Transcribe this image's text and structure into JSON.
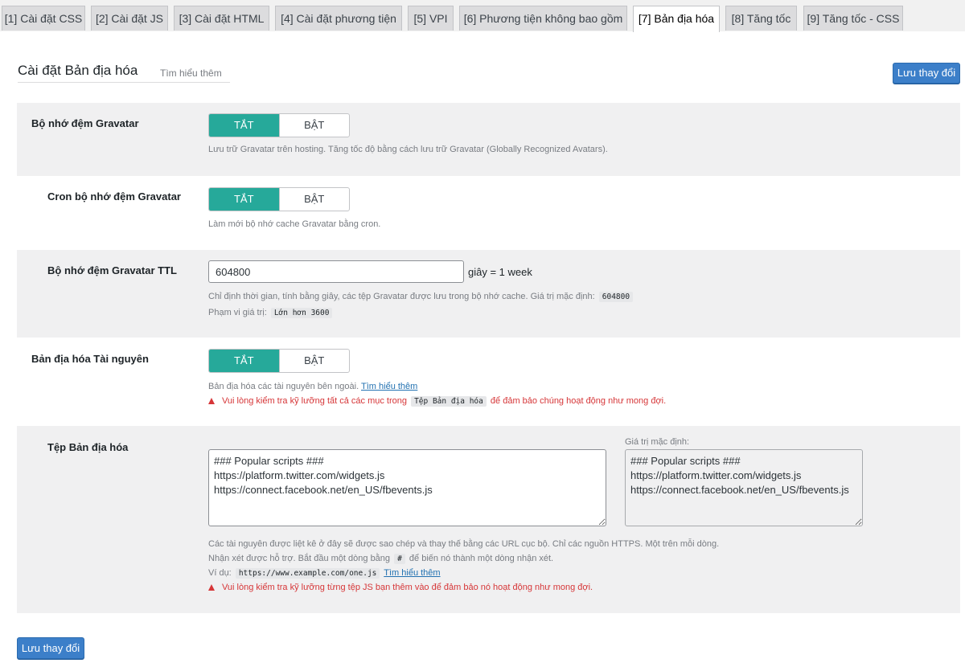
{
  "tabs": [
    {
      "label": "[1] Cài đặt CSS"
    },
    {
      "label": "[2] Cài đặt JS"
    },
    {
      "label": "[3] Cài đặt HTML"
    },
    {
      "label": "[4] Cài đặt phương tiện"
    },
    {
      "label": "[5] VPI"
    },
    {
      "label": "[6] Phương tiện không bao gồm"
    },
    {
      "label": "[7] Bản địa hóa"
    },
    {
      "label": "[8] Tăng tốc"
    },
    {
      "label": "[9] Tăng tốc - CSS"
    }
  ],
  "header": {
    "title": "Cài đặt Bản địa hóa",
    "learn_more": "Tìm hiểu thêm",
    "save_label": "Lưu thay đổi"
  },
  "gravatar_cache": {
    "label": "Bộ nhớ đệm Gravatar",
    "off": "TẮT",
    "on": "BẬT",
    "selected": "off",
    "desc": "Lưu trữ Gravatar trên hosting. Tăng tốc độ bằng cách lưu trữ Gravatar (Globally Recognized Avatars)."
  },
  "gravatar_cron": {
    "label": "Cron bộ nhớ đệm Gravatar",
    "off": "TẮT",
    "on": "BẬT",
    "selected": "off",
    "desc": "Làm mới bộ nhớ cache Gravatar bằng cron."
  },
  "gravatar_ttl": {
    "label": "Bộ nhớ đệm Gravatar TTL",
    "value": "604800",
    "suffix": "giây = 1 week",
    "desc": "Chỉ định thời gian, tính bằng giây, các tệp Gravatar được lưu trong bộ nhớ cache. Giá trị mặc định:",
    "default_value": "604800",
    "range_label": "Phạm vi giá trị:",
    "range_value": "Lớn hơn 3600"
  },
  "localize_resources": {
    "label": "Bản địa hóa Tài nguyên",
    "off": "TẮT",
    "on": "BẬT",
    "selected": "off",
    "desc": "Bản địa hóa các tài nguyên bên ngoài.",
    "learn_more": "Tìm hiểu thêm",
    "warn_before": "Vui lòng kiểm tra kỹ lưỡng tất cả các mục trong",
    "warn_code": "Tệp Bản địa hóa",
    "warn_after": "để đảm bảo chúng hoạt động như mong đợi."
  },
  "localize_files": {
    "label": "Tệp Bản địa hóa",
    "value": "### Popular scripts ###\nhttps://platform.twitter.com/widgets.js\nhttps://connect.facebook.net/en_US/fbevents.js",
    "default_label": "Giá trị mặc định:",
    "default_value": "### Popular scripts ###\nhttps://platform.twitter.com/widgets.js\nhttps://connect.facebook.net/en_US/fbevents.js",
    "desc1": "Các tài nguyên được liệt kê ở đây sẽ được sao chép và thay thế bằng các URL cục bộ. Chỉ các nguồn HTTPS. Một trên mỗi dòng.",
    "desc2_before": "Nhận xét được hỗ trợ. Bắt đầu một dòng bằng",
    "desc2_code": "#",
    "desc2_after": "để biến nó thành một dòng nhận xét.",
    "example_label": "Ví dụ:",
    "example_code": "https://www.example.com/one.js",
    "learn_more": "Tìm hiểu thêm",
    "warn": "Vui lòng kiểm tra kỹ lưỡng từng tệp JS bạn thêm vào để đảm bảo nó hoạt động như mong đợi."
  },
  "footer": {
    "save_label": "Lưu thay đổi"
  },
  "colors": {
    "toggle_active": "#26a99a",
    "primary_button": "#3c7fc9",
    "warning": "#d63638",
    "link": "#2271b1"
  }
}
